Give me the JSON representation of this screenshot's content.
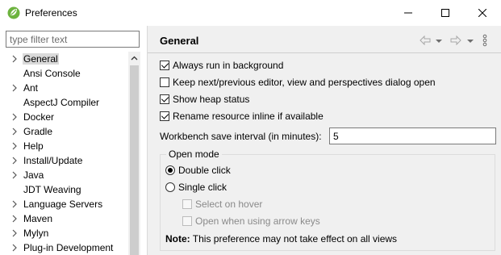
{
  "window": {
    "title": "Preferences",
    "app_icon": "eclipse-spring-leaf-icon",
    "controls": [
      "minimize-icon",
      "maximize-icon",
      "close-icon"
    ]
  },
  "filter": {
    "placeholder": "type filter text"
  },
  "tree": {
    "items": [
      {
        "label": "General",
        "expandable": true,
        "selected": true
      },
      {
        "label": "Ansi Console",
        "expandable": false
      },
      {
        "label": "Ant",
        "expandable": true
      },
      {
        "label": "AspectJ Compiler",
        "expandable": false
      },
      {
        "label": "Docker",
        "expandable": true
      },
      {
        "label": "Gradle",
        "expandable": true
      },
      {
        "label": "Help",
        "expandable": true
      },
      {
        "label": "Install/Update",
        "expandable": true
      },
      {
        "label": "Java",
        "expandable": true
      },
      {
        "label": "JDT Weaving",
        "expandable": false
      },
      {
        "label": "Language Servers",
        "expandable": true
      },
      {
        "label": "Maven",
        "expandable": true
      },
      {
        "label": "Mylyn",
        "expandable": true
      },
      {
        "label": "Plug-in Development",
        "expandable": true
      }
    ]
  },
  "page": {
    "title": "General",
    "options": [
      {
        "label": "Always run in background",
        "checked": true
      },
      {
        "label": "Keep next/previous editor, view and perspectives dialog open",
        "checked": false
      },
      {
        "label": "Show heap status",
        "checked": true
      },
      {
        "label": "Rename resource inline if available",
        "checked": true
      }
    ],
    "workbench_save": {
      "label": "Workbench save interval (in minutes):",
      "value": "5"
    },
    "open_mode": {
      "title": "Open mode",
      "double_click": "Double click",
      "single_click": "Single click",
      "selected": "double",
      "select_on_hover": "Select on hover",
      "open_arrow_keys": "Open when using arrow keys"
    },
    "note": {
      "label": "Note:",
      "text": "This preference may not take effect on all views"
    }
  }
}
